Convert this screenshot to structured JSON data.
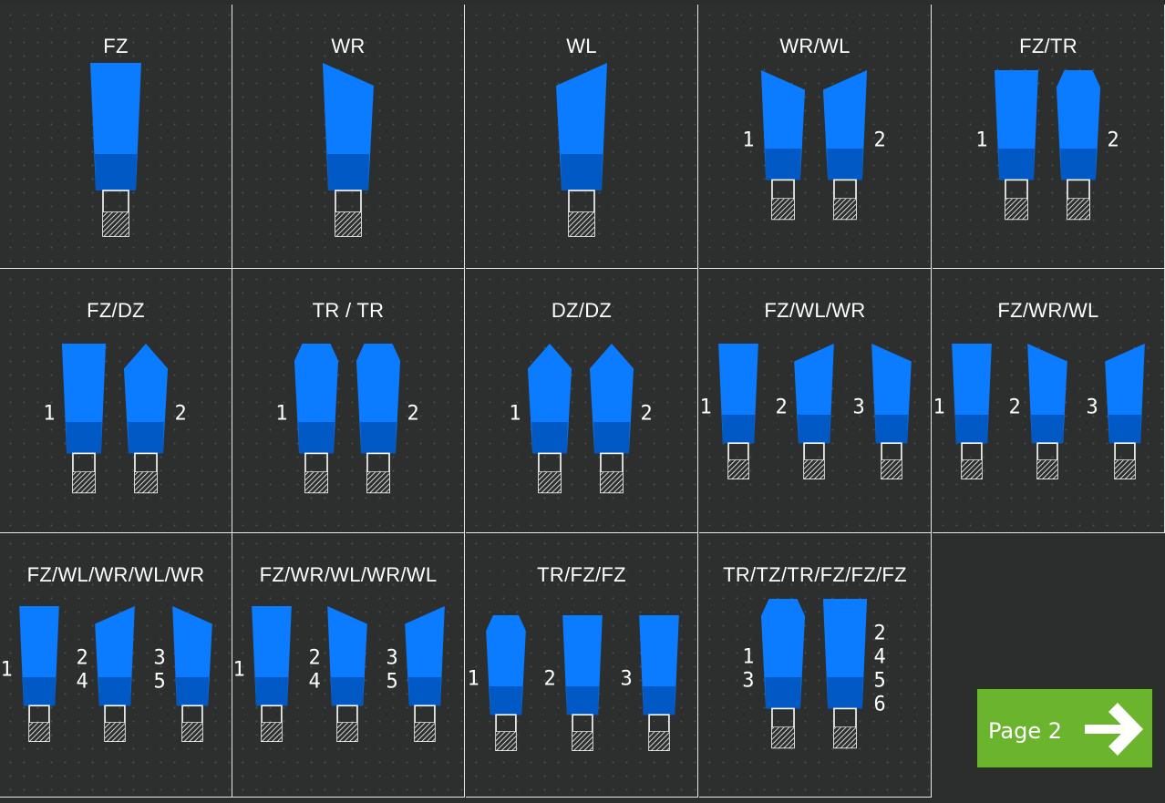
{
  "cells": [
    {
      "title": "FZ",
      "tools": [
        {
          "shape": "fz",
          "num": ""
        }
      ]
    },
    {
      "title": "WR",
      "tools": [
        {
          "shape": "wr",
          "num": ""
        }
      ]
    },
    {
      "title": "WL",
      "tools": [
        {
          "shape": "wl",
          "num": ""
        }
      ]
    },
    {
      "title": "WR/WL",
      "tools": [
        {
          "shape": "wr",
          "num": "1"
        },
        {
          "shape": "wl",
          "num": "2"
        }
      ]
    },
    {
      "title": "FZ/TR",
      "tools": [
        {
          "shape": "fz",
          "num": "1"
        },
        {
          "shape": "tr",
          "num": "2"
        }
      ]
    },
    {
      "title": "FZ/DZ",
      "tools": [
        {
          "shape": "fz",
          "num": "1"
        },
        {
          "shape": "dz",
          "num": "2"
        }
      ]
    },
    {
      "title": "TR / TR",
      "tools": [
        {
          "shape": "tr",
          "num": "1"
        },
        {
          "shape": "tr",
          "num": "2"
        }
      ]
    },
    {
      "title": "DZ/DZ",
      "tools": [
        {
          "shape": "dz",
          "num": "1"
        },
        {
          "shape": "dz",
          "num": "2"
        }
      ]
    },
    {
      "title": "FZ/WL/WR",
      "tools": [
        {
          "shape": "fz",
          "num": "1"
        },
        {
          "shape": "wl",
          "num": "2"
        },
        {
          "shape": "wr",
          "num": "3"
        }
      ]
    },
    {
      "title": "FZ/WR/WL",
      "tools": [
        {
          "shape": "fz",
          "num": "1"
        },
        {
          "shape": "wr",
          "num": "2"
        },
        {
          "shape": "wl",
          "num": "3"
        }
      ]
    },
    {
      "title": "FZ/WL/WR/WL/WR",
      "tools": [
        {
          "shape": "fz",
          "num": "1"
        },
        {
          "shape": "wl",
          "num": "2\n4"
        },
        {
          "shape": "wr",
          "num": "3\n5"
        }
      ]
    },
    {
      "title": "FZ/WR/WL/WR/WL",
      "tools": [
        {
          "shape": "fz",
          "num": "1"
        },
        {
          "shape": "wr",
          "num": "2\n4"
        },
        {
          "shape": "wl",
          "num": "3\n5"
        }
      ]
    },
    {
      "title": "TR/FZ/FZ",
      "tools": [
        {
          "shape": "tr",
          "num": "1"
        },
        {
          "shape": "fz",
          "num": "2"
        },
        {
          "shape": "fz",
          "num": "3"
        }
      ]
    },
    {
      "title": "TR/TZ/TR/FZ/FZ/FZ",
      "tools": [
        {
          "shape": "tr",
          "num": "1\n3"
        },
        {
          "shape": "fz",
          "num": "2\n4\n5\n6"
        }
      ]
    }
  ],
  "page_button": {
    "label": "Page 2"
  },
  "colors": {
    "blade": "#0b7bff",
    "band": "#0059c4",
    "button": "#6ab42e"
  }
}
